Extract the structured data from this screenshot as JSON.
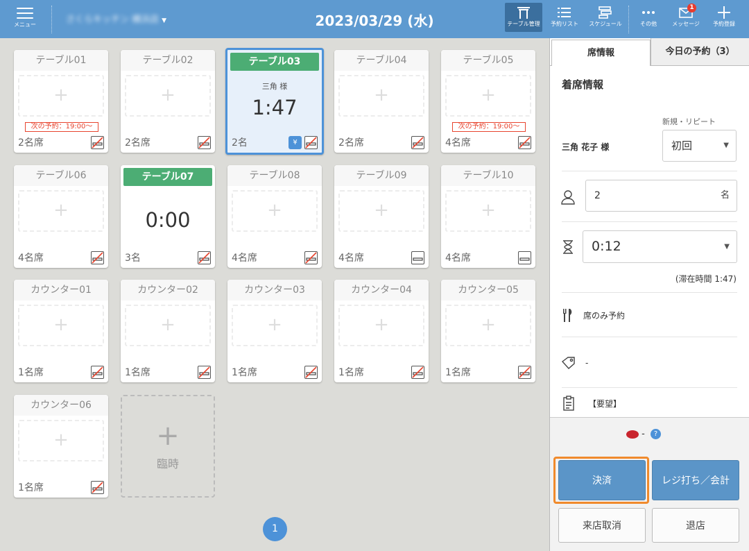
{
  "header": {
    "menu_label": "メニュー",
    "store_name": "さくらキッチン 横浜店",
    "date": "2023/03/29 (水)",
    "buttons": [
      {
        "label": "テーブル管理",
        "icon": "table-gate-icon",
        "active": true
      },
      {
        "label": "予約リスト",
        "icon": "list-icon"
      },
      {
        "label": "スケジュール",
        "icon": "schedule-icon"
      },
      {
        "label": "その他",
        "icon": "more-icon"
      },
      {
        "label": "メッセージ",
        "icon": "mail-icon",
        "badge": "1"
      },
      {
        "label": "予約登録",
        "icon": "plus-icon"
      }
    ]
  },
  "tables": [
    {
      "name": "テーブル01",
      "seats": "2名席",
      "next": "次の予約：19:00〜",
      "smoking": false
    },
    {
      "name": "テーブル02",
      "seats": "2名席",
      "smoking": false
    },
    {
      "name": "テーブル03",
      "occupied": true,
      "selected": true,
      "guest": "三角 様",
      "time": "1:47",
      "seats": "2名",
      "smoking": false
    },
    {
      "name": "テーブル04",
      "seats": "2名席",
      "smoking": false
    },
    {
      "name": "テーブル05",
      "seats": "4名席",
      "next": "次の予約：19:00〜",
      "smoking": false
    },
    {
      "name": "テーブル06",
      "seats": "4名席",
      "smoking": false
    },
    {
      "name": "テーブル07",
      "occupied": true,
      "time": "0:00",
      "seats": "3名",
      "smoking": false
    },
    {
      "name": "テーブル08",
      "seats": "4名席",
      "smoking": false
    },
    {
      "name": "テーブル09",
      "seats": "4名席",
      "smoking": true
    },
    {
      "name": "テーブル10",
      "seats": "4名席",
      "smoking": true
    },
    {
      "name": "カウンター01",
      "seats": "1名席",
      "smoking": false
    },
    {
      "name": "カウンター02",
      "seats": "1名席",
      "smoking": false
    },
    {
      "name": "カウンター03",
      "seats": "1名席",
      "smoking": false
    },
    {
      "name": "カウンター04",
      "seats": "1名席",
      "smoking": false
    },
    {
      "name": "カウンター05",
      "seats": "1名席",
      "smoking": false
    },
    {
      "name": "カウンター06",
      "seats": "1名席",
      "smoking": false
    }
  ],
  "temp_label": "臨時",
  "page": "1",
  "panel": {
    "tab_info": "席情報",
    "tab_today": "今日の予約（3）",
    "section_title": "着席情報",
    "visit_type_label": "新規・リピート",
    "guest_name": "三角 花子 様",
    "visit_type": "初回",
    "party_size": "2",
    "party_unit": "名",
    "duration": "0:12",
    "stay_time": "(滞在時間 1:47)",
    "plan": "席のみ予約",
    "tag": "-",
    "memo": "【要望】",
    "points": "-",
    "btn_pay": "決済",
    "btn_register": "レジ打ち／会計",
    "btn_cancel": "来店取消",
    "btn_leave": "退店"
  }
}
